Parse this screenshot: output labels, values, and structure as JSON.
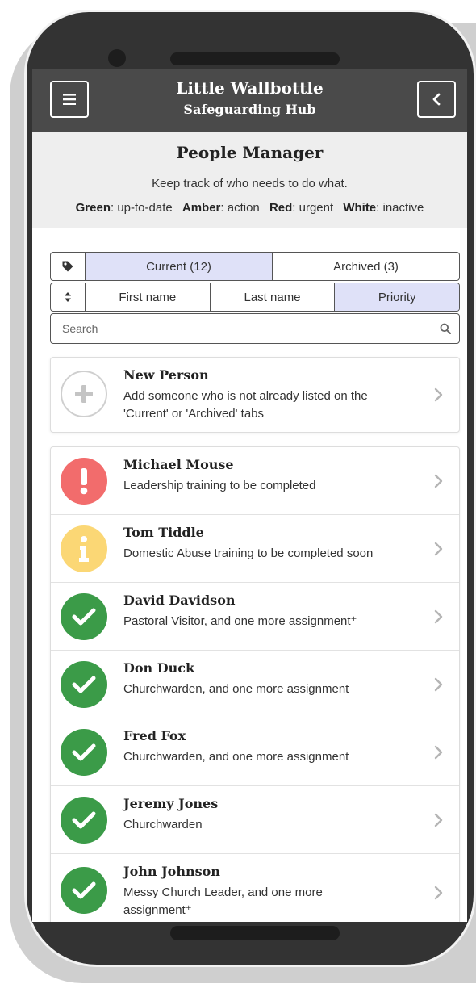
{
  "app": {
    "title": "Little Wallbottle",
    "subtitle": "Safeguarding Hub"
  },
  "header": {
    "title": "People Manager",
    "description": "Keep track of who needs to do what.",
    "legend": [
      {
        "label": "Green",
        "text": ": up-to-date"
      },
      {
        "label": "Amber",
        "text": ": action"
      },
      {
        "label": "Red",
        "text": ": urgent"
      },
      {
        "label": "White",
        "text": ": inactive"
      }
    ]
  },
  "tabs": {
    "icon": "tag-icon",
    "items": [
      {
        "label": "Current (12)",
        "active": true
      },
      {
        "label": "Archived (3)",
        "active": false
      }
    ]
  },
  "sort": {
    "icon": "sort-icon",
    "items": [
      {
        "label": "First name",
        "active": false
      },
      {
        "label": "Last name",
        "active": false
      },
      {
        "label": "Priority",
        "active": true
      }
    ]
  },
  "search": {
    "placeholder": "Search",
    "value": ""
  },
  "new_person": {
    "name": "New Person",
    "description": "Add someone who is not already listed on the 'Current' or 'Archived' tabs"
  },
  "colors": {
    "red": "#f26c6c",
    "amber": "#fbd775",
    "green": "#3b9b48",
    "topbar": "#4a4a4a",
    "active_tab": "#dfe1f8"
  },
  "people": [
    {
      "name": "Michael Mouse",
      "description": "Leadership  training  to be completed",
      "status": "red",
      "icon": "exclamation-icon"
    },
    {
      "name": "Tom Tiddle",
      "description": "Domestic Abuse  training  to be completed soon",
      "status": "amber",
      "icon": "info-icon"
    },
    {
      "name": "David Davidson",
      "description": "Pastoral Visitor, and one more assignment⁺",
      "status": "green",
      "icon": "check-icon"
    },
    {
      "name": "Don Duck",
      "description": "Churchwarden, and one more assignment",
      "status": "green",
      "icon": "check-icon"
    },
    {
      "name": "Fred Fox",
      "description": "Churchwarden, and one more assignment",
      "status": "green",
      "icon": "check-icon"
    },
    {
      "name": "Jeremy Jones",
      "description": "Churchwarden",
      "status": "green",
      "icon": "check-icon"
    },
    {
      "name": "John Johnson",
      "description": "Messy Church Leader, and one more assignment⁺",
      "status": "green",
      "icon": "check-icon"
    }
  ]
}
